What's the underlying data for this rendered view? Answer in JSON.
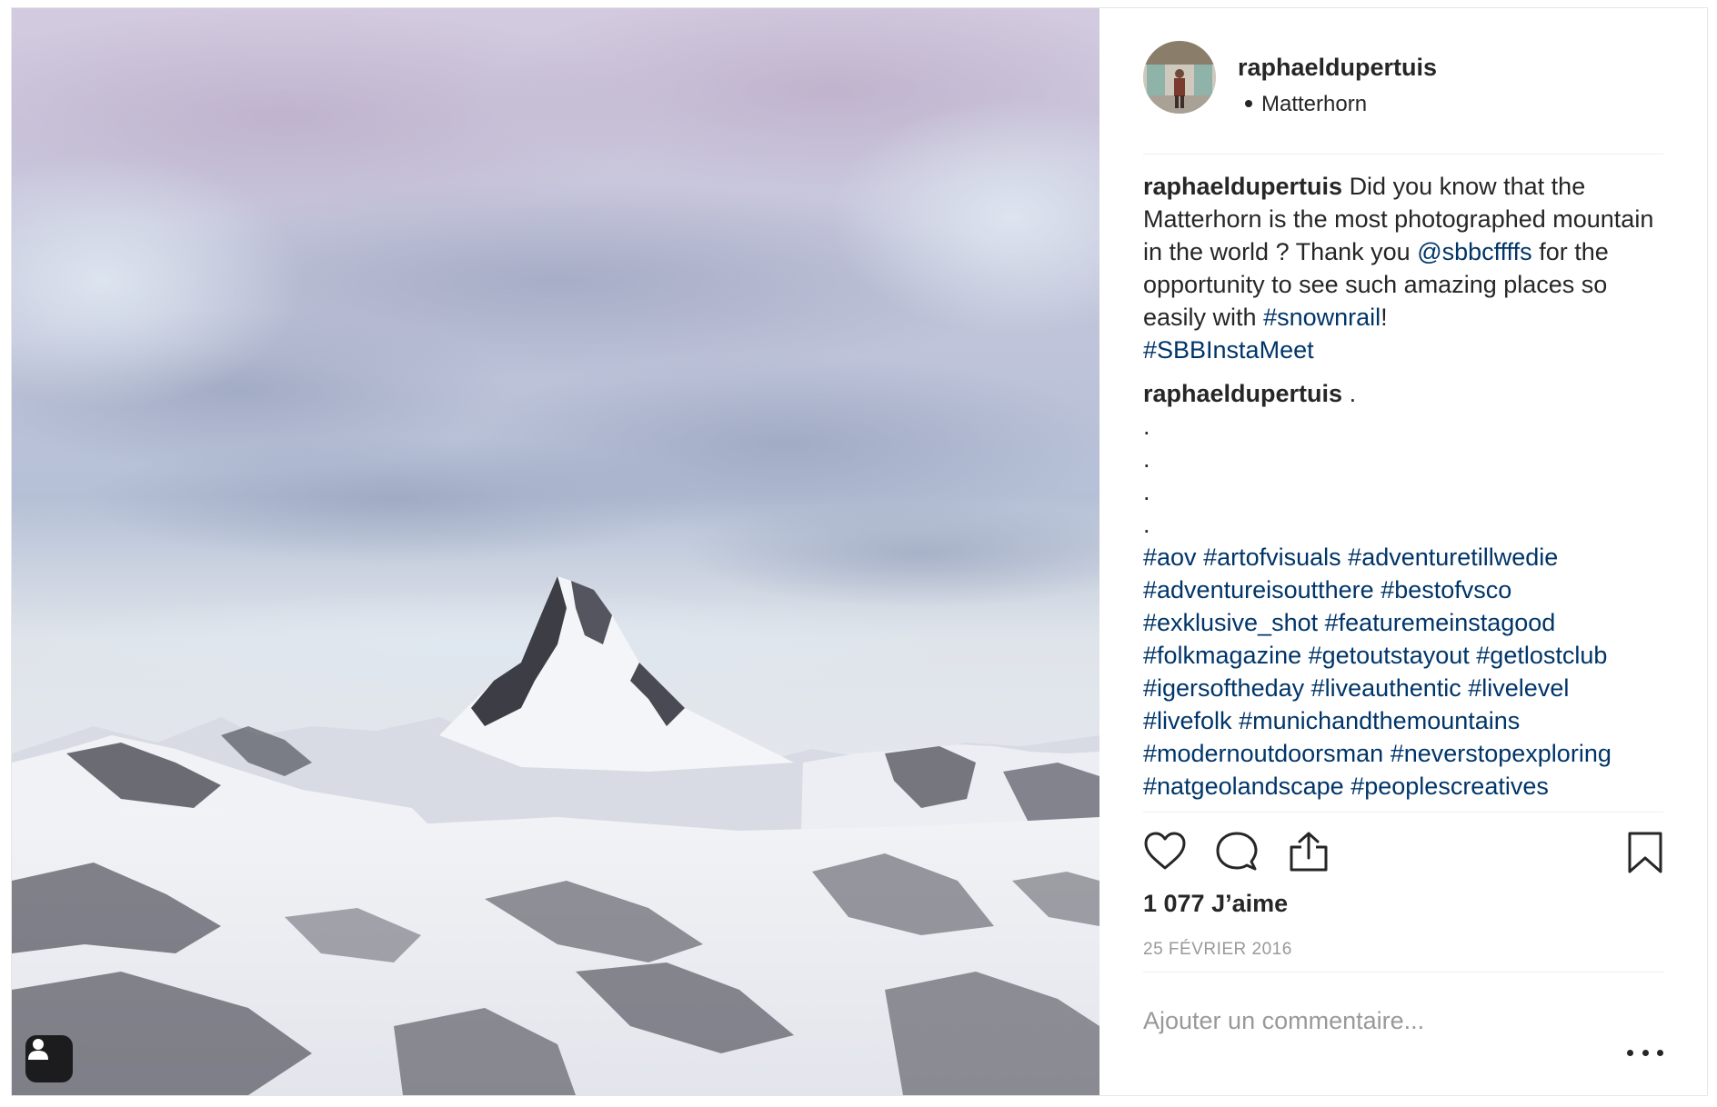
{
  "post": {
    "username": "raphaeldupertuis",
    "location": "Matterhorn",
    "caption": {
      "username": "raphaeldupertuis",
      "text_1": "Did you know that the Matterhorn is the most photographed mountain in the world ? Thank you",
      "mention": "@sbbcffffs",
      "text_2": "for the opportunity to see such amazing places so easily with",
      "hashtag_1": "#snownrail",
      "text_3": "!",
      "hashtag_2": "#SBBInstaMeet"
    },
    "second_comment": {
      "username": "raphaeldupertuis",
      "first_line": ".",
      "dots": [
        ".",
        ".",
        ".",
        "."
      ],
      "hashtags": [
        "#aov",
        "#artofvisuals",
        "#adventuretillwedie",
        "#adventureisoutthere",
        "#bestofvsco",
        "#exklusive_shot",
        "#featuremeinstagood",
        "#folkmagazine",
        "#getoutstayout",
        "#getlostclub",
        "#igersoftheday",
        "#liveauthentic",
        "#livelevel",
        "#livefolk",
        "#munichandthemountains",
        "#modernoutdoorsman",
        "#neverstopexploring",
        "#natgeolandscape",
        "#peoplescreatives"
      ]
    },
    "likes": "1 077 J’aime",
    "date": "25 FÉVRIER 2016",
    "comment_placeholder": "Ajouter un commentaire..."
  },
  "icons": {
    "like": "heart-icon",
    "comment": "speech-bubble-icon",
    "share": "share-icon",
    "save": "bookmark-icon",
    "tags": "user-tag-icon",
    "more": "more-options-icon"
  },
  "colors": {
    "text": "#262626",
    "link": "#003569",
    "muted": "#999999",
    "divider": "#efefef"
  }
}
